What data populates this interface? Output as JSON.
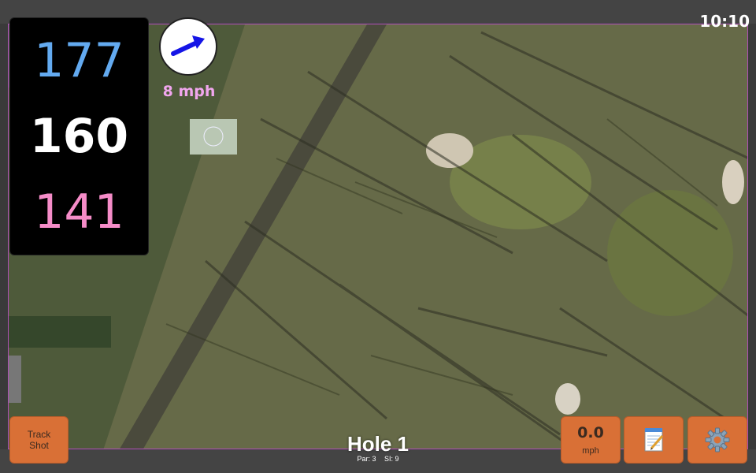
{
  "status_bar": {
    "time": "10:10"
  },
  "distances": {
    "back": "177",
    "middle": "160",
    "front": "141"
  },
  "wind": {
    "speed_label": "8 mph",
    "direction_icon": "arrow-icon"
  },
  "hole": {
    "title": "Hole 1",
    "par_label": "Par: 3",
    "si_label": "SI: 9"
  },
  "buttons": {
    "track_shot_line1": "Track",
    "track_shot_line2": "Shot",
    "speed_value": "0.0",
    "speed_unit": "mph",
    "notes_icon": "notepad-icon",
    "settings_icon": "gear-icon"
  },
  "colors": {
    "back_distance": "#63aaf0",
    "middle_distance": "#ffffff",
    "front_distance": "#f58cc8",
    "wind_speed": "#f1a6ee",
    "button": "#d97036"
  }
}
